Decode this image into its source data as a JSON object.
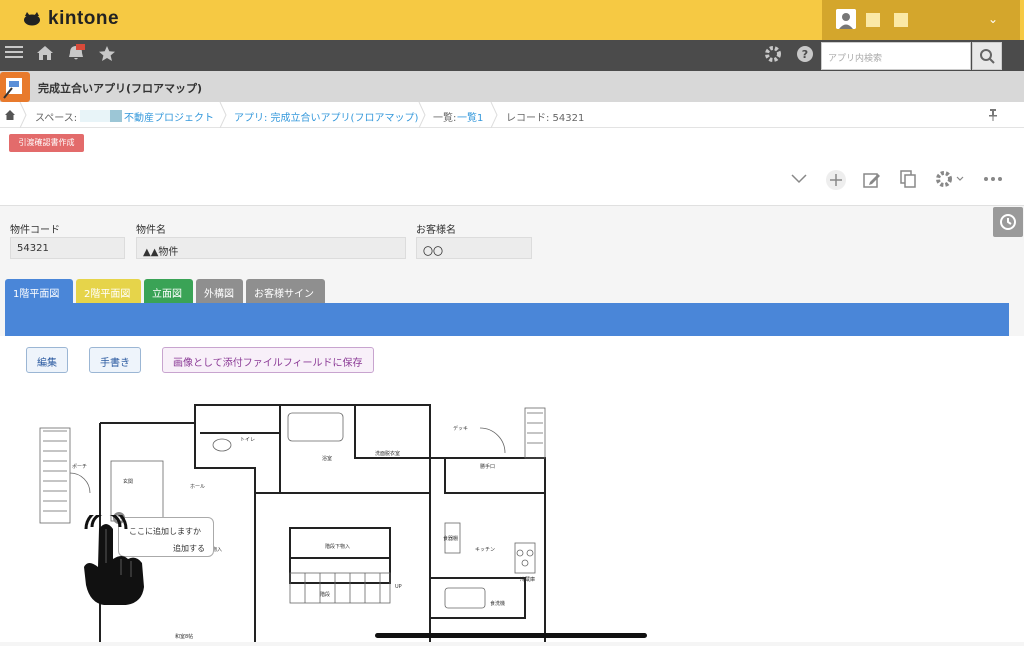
{
  "app": {
    "brand": "kintone",
    "title": "完成立合いアプリ(フロアマップ)"
  },
  "search": {
    "placeholder": "アプリ内検索"
  },
  "breadcrumb": {
    "space_label": "スペース:",
    "space_name": "不動産プロジェクト",
    "app_link": "アプリ: 完成立合いアプリ(フロアマップ)",
    "list_prefix": "一覧:",
    "list_link": "一覧1",
    "record": "レコード: 54321"
  },
  "actions": {
    "issue_button": "引渡確認書作成"
  },
  "fields": [
    {
      "label": "物件コード",
      "value": "54321"
    },
    {
      "label": "物件名",
      "value": "▲▲物件"
    },
    {
      "label": "お客様名",
      "value": "〇〇"
    }
  ],
  "tabs": [
    {
      "label": "1階平面図",
      "color": "#4a86d8"
    },
    {
      "label": "2階平面図",
      "color": "#e6d44a"
    },
    {
      "label": "立面図",
      "color": "#3aa356"
    },
    {
      "label": "外構図",
      "color": "#8f8f8f"
    },
    {
      "label": "お客様サイン",
      "color": "#8f8f8f"
    }
  ],
  "editor_buttons": {
    "edit": "編集",
    "handwrite": "手書き",
    "save_image": "画像として添付ファイルフィールドに保存"
  },
  "floorplan": {
    "rooms": [
      "ポーチ",
      "玄関",
      "ホール",
      "トイレ",
      "浴室",
      "洗面脱衣室",
      "デッキ",
      "勝手口",
      "キッチン",
      "食洗機",
      "階段下物入",
      "階段",
      "和室8帖",
      "物入",
      "食器棚",
      "冷蔵庫",
      "階段下物入",
      "UP"
    ],
    "popup_title": "ここに追加しますか",
    "popup_action": "追加する"
  },
  "colors": {
    "topbar": "#f6c943",
    "navbar": "#4b4b4b",
    "accent": "#4a86d8",
    "red_button": "#e36b6b"
  },
  "icons": [
    "menu-icon",
    "home-icon",
    "notification-icon",
    "favorite-icon",
    "settings-icon",
    "help-icon",
    "search-icon",
    "user-icon",
    "chevron-down-icon",
    "add-icon",
    "edit-icon",
    "copy-icon",
    "gear-icon",
    "more-icon",
    "pin-icon",
    "clock-icon",
    "close-icon",
    "hand-pointer-icon"
  ]
}
